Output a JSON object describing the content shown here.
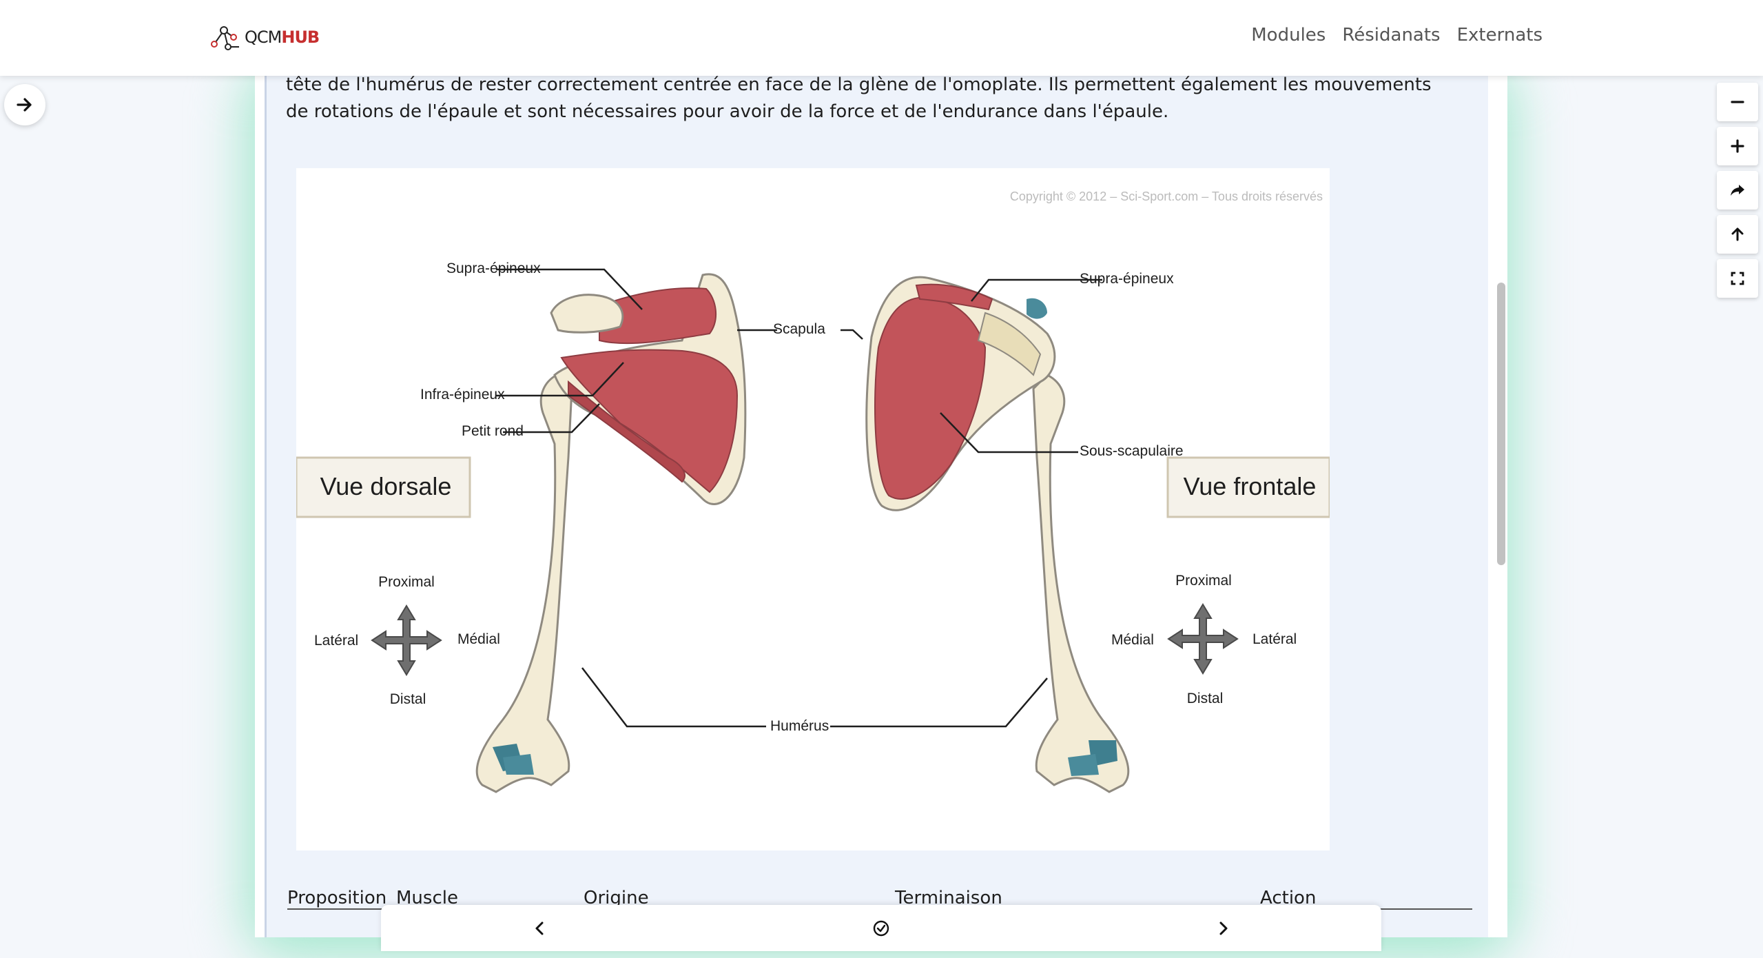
{
  "header": {
    "logo_text_1": "QCM",
    "logo_text_2": "HUB",
    "nav": [
      "Modules",
      "Résidanats",
      "Externats"
    ]
  },
  "content": {
    "paragraph_lines": [
      "tête de l'humérus de rester correctement centrée en face de la glène de l'omoplate. Ils permettent également les mouvements",
      "de rotations de l'épaule et sont nécessaires pour avoir de la force et de l'endurance dans l'épaule."
    ]
  },
  "figure": {
    "copyright": "Copyright © 2012 – Sci-Sport.com – Tous droits réservés",
    "labels": {
      "supra_left": "Supra-épineux",
      "supra_right": "Supra-épineux",
      "scapula": "Scapula",
      "infra": "Infra-épineux",
      "petit_rond": "Petit rond",
      "sous_scapulaire": "Sous-scapulaire",
      "vue_dorsale": "Vue dorsale",
      "vue_frontale": "Vue frontale",
      "proximal_left": "Proximal",
      "distal_left": "Distal",
      "lateral_left": "Latéral",
      "medial_left": "Médial",
      "proximal_right": "Proximal",
      "distal_right": "Distal",
      "lateral_right": "Latéral",
      "medial_right": "Médial",
      "humerus": "Humérus"
    }
  },
  "table": {
    "headers": [
      "Proposition",
      "Muscle",
      "Origine",
      "Terminaison",
      "Action"
    ]
  },
  "colors": {
    "brand_red": "#c62f2f",
    "glow": "#a6e8cf",
    "muscle": "#c2545a",
    "bone": "#f3ecd6"
  },
  "icons": {
    "left_toggle": "arrow-right-icon",
    "tools": [
      "minus-icon",
      "plus-icon",
      "share-icon",
      "arrow-up-icon",
      "fullscreen-icon"
    ],
    "bottom": [
      "chevron-left-icon",
      "check-circle-icon",
      "chevron-right-icon"
    ]
  }
}
